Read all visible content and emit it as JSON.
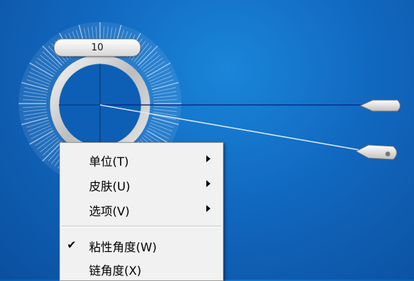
{
  "gadget": {
    "angle_value": "10",
    "icon": "protractor-gadget"
  },
  "context_menu": {
    "items": [
      {
        "label": "单位(T)",
        "submenu": true,
        "checked": false
      },
      {
        "label": "皮肤(U)",
        "submenu": true,
        "checked": false
      },
      {
        "label": "选项(V)",
        "submenu": true,
        "checked": false
      },
      {
        "label": "粘性角度(W)",
        "submenu": false,
        "checked": true
      },
      {
        "label": "链角度(X)",
        "submenu": false,
        "checked": false
      }
    ],
    "check_glyph": "✔"
  },
  "colors": {
    "desktop_blue": "#1168bf",
    "dial_ticks": "#b9d3ee",
    "ring_silver": "#c9c9c9",
    "menu_bg": "#f1f1f1"
  }
}
